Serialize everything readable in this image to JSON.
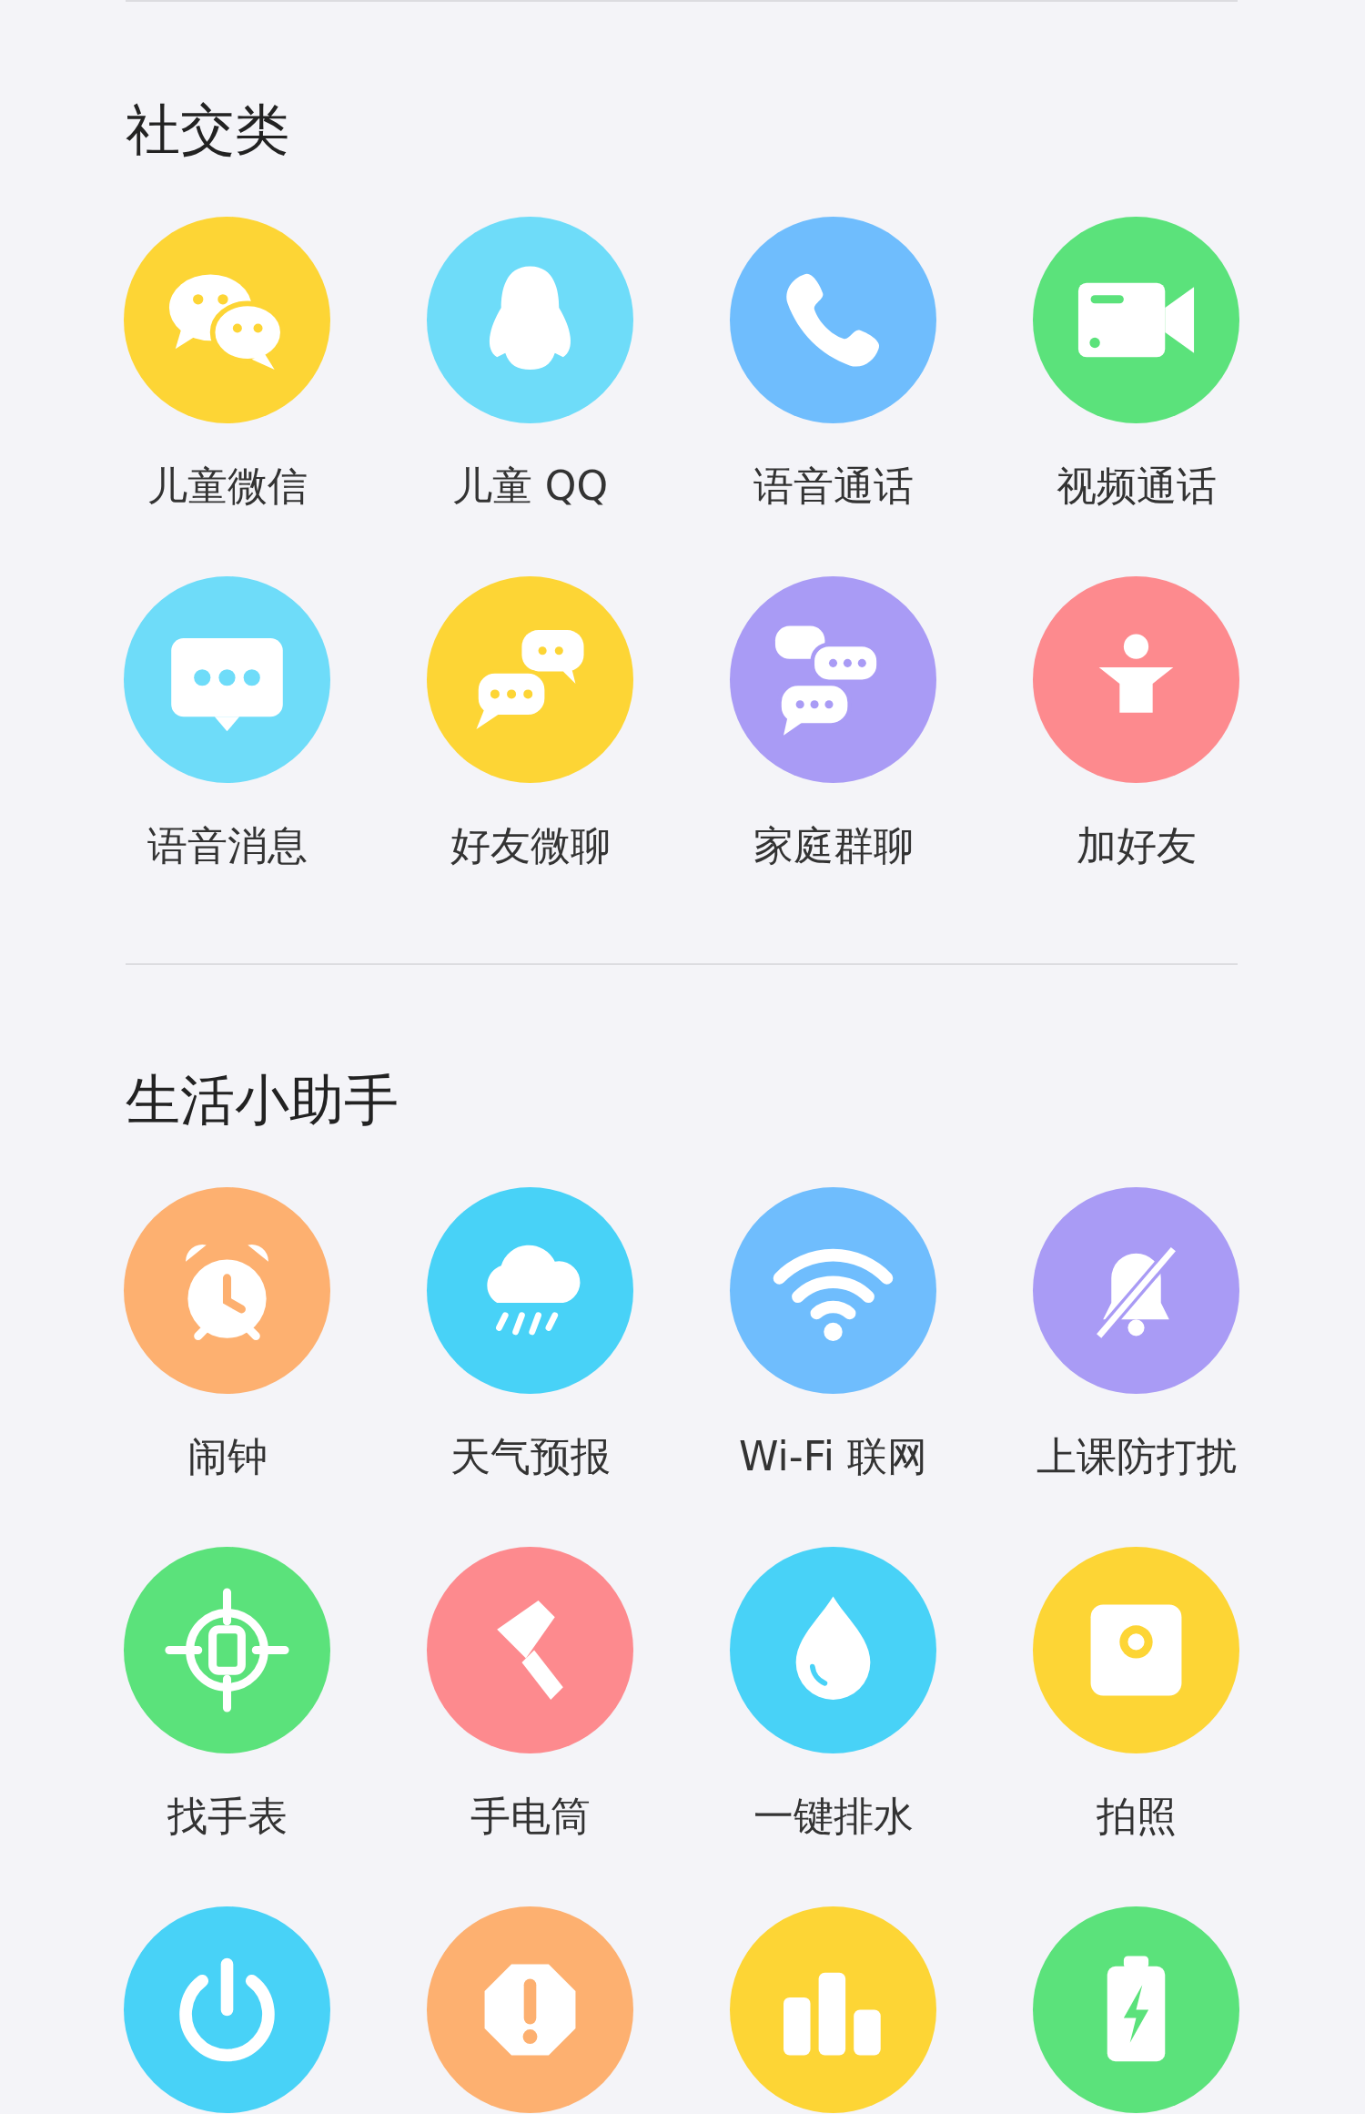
{
  "sections": [
    {
      "title": "社交类",
      "apps": [
        {
          "label": "儿童微信",
          "kind": "wechat",
          "color": "#fdd535"
        },
        {
          "label": "儿童 QQ",
          "kind": "penguin",
          "color": "#6edcf9"
        },
        {
          "label": "语音通话",
          "kind": "phone",
          "color": "#6fbdfd"
        },
        {
          "label": "视频通话",
          "kind": "video",
          "color": "#5be27b"
        },
        {
          "label": "语音消息",
          "kind": "message",
          "color": "#6edcf9"
        },
        {
          "label": "好友微聊",
          "kind": "chat",
          "color": "#fdd535"
        },
        {
          "label": "家庭群聊",
          "kind": "group",
          "color": "#a99bf5"
        },
        {
          "label": "加好友",
          "kind": "person",
          "color": "#fd8a8e"
        }
      ]
    },
    {
      "title": "生活小助手",
      "apps": [
        {
          "label": "闹钟",
          "kind": "alarm",
          "color": "#fdb070"
        },
        {
          "label": "天气预报",
          "kind": "rain",
          "color": "#48d2f7"
        },
        {
          "label": "Wi-Fi 联网",
          "kind": "wifi",
          "color": "#6fbdfd"
        },
        {
          "label": "上课防打扰",
          "kind": "mute",
          "color": "#a99bf5"
        },
        {
          "label": "找手表",
          "kind": "locate",
          "color": "#5be27b"
        },
        {
          "label": "手电筒",
          "kind": "flashlight",
          "color": "#fd8a8e"
        },
        {
          "label": "一键排水",
          "kind": "drop",
          "color": "#48d2f7"
        },
        {
          "label": "拍照",
          "kind": "camera",
          "color": "#fdd535"
        },
        {
          "kind": "power",
          "color": "#48d2f7"
        },
        {
          "kind": "alert",
          "color": "#fdb070"
        },
        {
          "kind": "bars",
          "color": "#fdd535"
        },
        {
          "kind": "battery",
          "color": "#5be27b"
        }
      ]
    }
  ]
}
